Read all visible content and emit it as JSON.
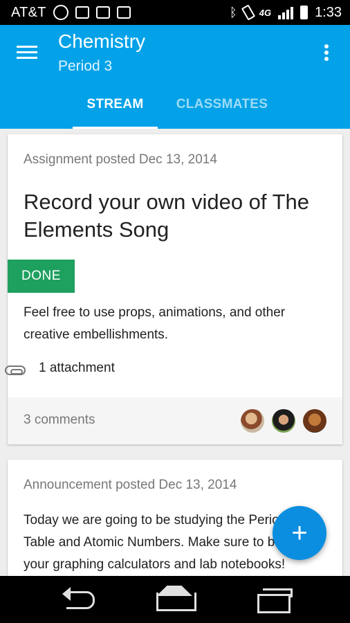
{
  "status_bar": {
    "carrier": "AT&T",
    "network": "4G",
    "time": "1:33",
    "icons": [
      "hangouts-icon",
      "gmail-icon",
      "image-icon",
      "gmail-icon",
      "bluetooth-icon",
      "vibrate-icon",
      "signal-icon",
      "battery-icon"
    ]
  },
  "app_bar": {
    "title": "Chemistry",
    "subtitle": "Period 3",
    "color": "#03a2e8",
    "tabs": [
      {
        "label": "STREAM",
        "active": true
      },
      {
        "label": "CLASSMATES",
        "active": false
      }
    ]
  },
  "stream": {
    "assignment": {
      "meta": "Assignment posted Dec 13, 2014",
      "title": "Record your own video of The Elements Song",
      "status": "DONE",
      "description": "Feel free to use props, animations, and other creative embellishments.",
      "attachments": "1 attachment",
      "comments": "3 comments"
    },
    "announcement": {
      "meta": "Announcement posted Dec 13, 2014",
      "lines": [
        "Today we are going to be studying the Periodic",
        "Table and Atomic Numbers. Make sure to bring",
        "your graphing calculators and lab notebooks!"
      ]
    }
  },
  "fab": {
    "icon": "plus-icon",
    "symbol": "+"
  },
  "colors": {
    "done": "#1ea05e",
    "fab": "#0b8ee0"
  }
}
